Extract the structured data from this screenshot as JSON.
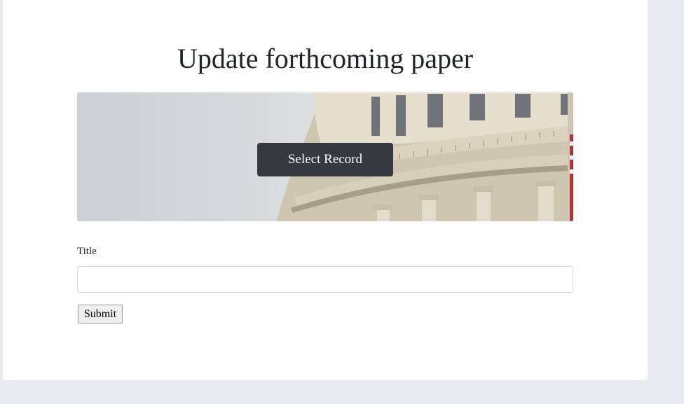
{
  "page": {
    "title": "Update forthcoming paper"
  },
  "hero": {
    "image": "capitol-dome-photo",
    "button_label": "Select Record"
  },
  "form": {
    "title_label": "Title",
    "title_value": "",
    "title_placeholder": "",
    "submit_label": "Submit"
  },
  "colors": {
    "background": "#e9ecef",
    "card": "#ffffff",
    "dark_button": "#343a40",
    "text": "#212529"
  }
}
